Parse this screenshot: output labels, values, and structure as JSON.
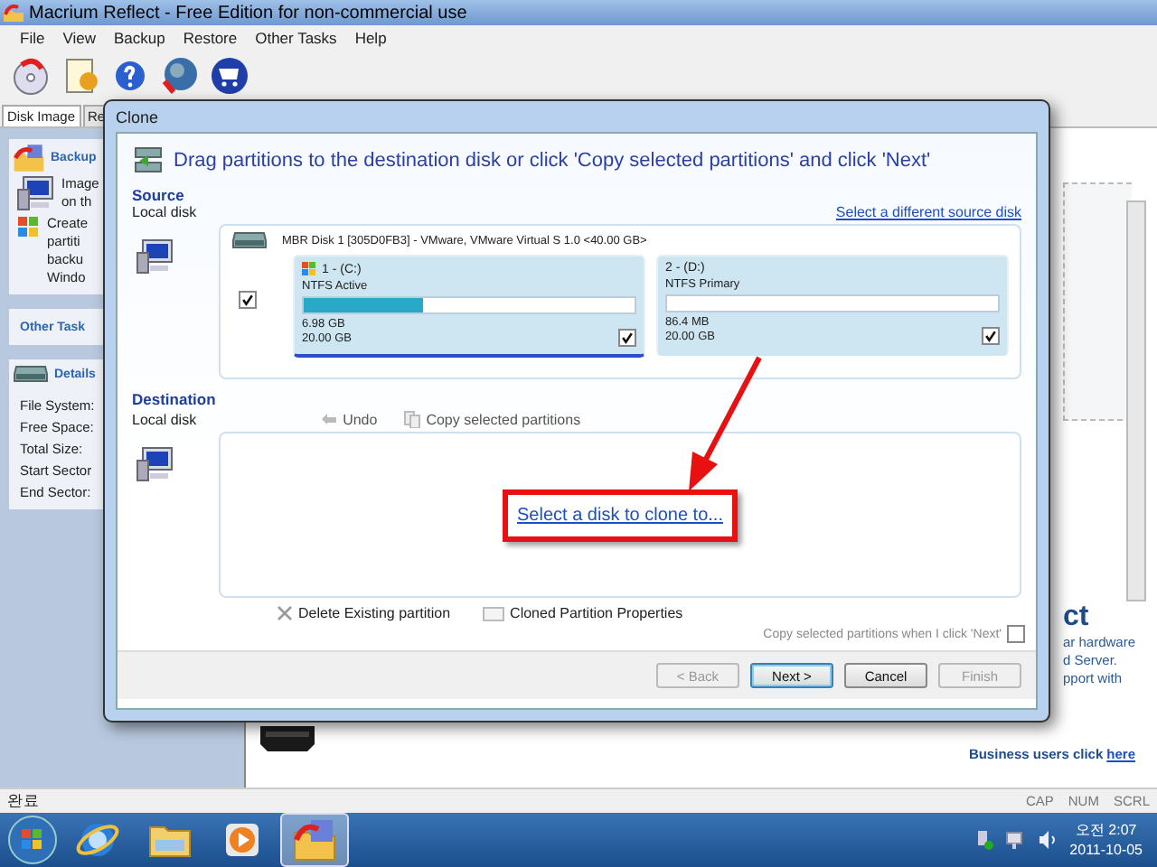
{
  "window": {
    "title": "Macrium Reflect - Free Edition for non-commercial use"
  },
  "menu": [
    "File",
    "View",
    "Backup",
    "Restore",
    "Other Tasks",
    "Help"
  ],
  "tabs": [
    {
      "label": "Disk Image",
      "selected": true
    },
    {
      "label": "Re",
      "selected": false
    }
  ],
  "sidebar": {
    "backup_title": "Backup",
    "backup_items": [
      [
        "Image",
        "on th"
      ],
      [
        "Create",
        "partiti",
        "backu",
        "Windo"
      ]
    ],
    "other_tasks": "Other Task",
    "details_title": "Details",
    "details_fields": [
      "File System:",
      "Free Space:",
      "Total Size:",
      "Start Sector",
      "End Sector:"
    ]
  },
  "right_panel": {
    "heading": "ct",
    "lines": [
      "ar hardware",
      "d Server.",
      "pport with"
    ],
    "footer": "Business users click",
    "footer_link": "here"
  },
  "dialog": {
    "title": "Clone",
    "instruction": "Drag partitions to the destination disk or click 'Copy selected partitions' and click 'Next'",
    "source": {
      "heading": "Source",
      "subheading": "Local disk",
      "link": "Select a different source disk",
      "disk": {
        "label": "MBR Disk 1 [305D0FB3] - VMware,  VMware Virtual S 1.0  <40.00 GB>",
        "checked": true,
        "partitions": [
          {
            "label": "1 - (C:)",
            "type": "NTFS Active",
            "level": 0.36,
            "used": "6.98 GB",
            "size": "20.00 GB",
            "checked": true,
            "selected": true
          },
          {
            "label": "2 - (D:)",
            "type": "NTFS Primary",
            "level": 0,
            "used": "86.4 MB",
            "size": "20.00 GB",
            "checked": true,
            "selected": false
          }
        ]
      }
    },
    "destination": {
      "heading": "Destination",
      "subheading": "Local disk",
      "undo": {
        "label": "Undo",
        "disabled": true
      },
      "copy": {
        "label": "Copy selected partitions",
        "disabled": true
      },
      "link": "Select a disk to clone to..."
    },
    "actions": [
      "Delete Existing partition",
      "Cloned Partition Properties"
    ],
    "copy_on_next": {
      "label": "Copy selected partitions when I click 'Next'",
      "checked": false
    },
    "buttons": [
      {
        "label": "< Back",
        "disabled": true,
        "default": false
      },
      {
        "label": "Next >",
        "disabled": false,
        "default": true
      },
      {
        "label": "Cancel",
        "disabled": false,
        "default": false
      },
      {
        "label": "Finish",
        "disabled": true,
        "default": false
      }
    ]
  },
  "status_bar": {
    "text": "완료",
    "indicators": [
      "CAP",
      "NUM",
      "SCRL"
    ]
  },
  "taskbar": {
    "apps": [
      {
        "kind": "browser",
        "selected": false
      },
      {
        "kind": "folder",
        "selected": false
      },
      {
        "kind": "media",
        "selected": false
      },
      {
        "kind": "backup",
        "selected": true
      }
    ],
    "time": "오전 2:07",
    "date": "2011-10-05"
  }
}
